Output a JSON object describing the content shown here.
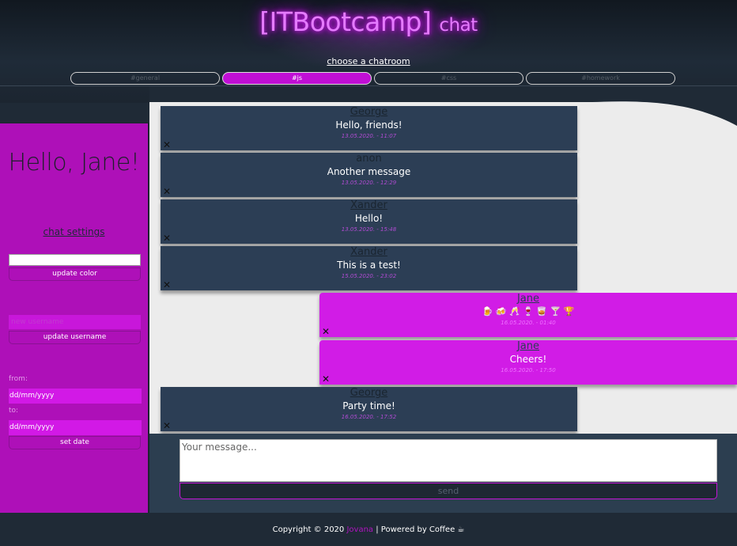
{
  "header": {
    "title_main": "[ITBootcamp]",
    "title_suffix": "chat",
    "choose_label": "choose a chatroom",
    "tabs": [
      {
        "label": "#general"
      },
      {
        "label": "#js"
      },
      {
        "label": "#css"
      },
      {
        "label": "#homework"
      }
    ],
    "active_tab": "#js"
  },
  "sidebar": {
    "greeting": "Hello, Jane!",
    "settings_link": "chat settings",
    "color_value": "",
    "update_color": "update color",
    "username_placeholder": "new username",
    "update_username": "update username",
    "from_label": "from:",
    "from_placeholder": "dd/mm/yyyy",
    "to_label": "to:",
    "to_placeholder": "dd/mm/yyyy",
    "set_date": "set date"
  },
  "messages": [
    {
      "author": "George",
      "text": "Hello, friends!",
      "time": "13.05.2020. - 11:07",
      "mine": false
    },
    {
      "author": "anon",
      "text": "Another message",
      "time": "13.05.2020. - 12:29",
      "mine": false
    },
    {
      "author": "Xander",
      "text": "Hello!",
      "time": "13.05.2020. - 15:48",
      "mine": false
    },
    {
      "author": "Xander",
      "text": "This is a test!",
      "time": "15.05.2020. - 23:02",
      "mine": false
    },
    {
      "author": "Jane",
      "text": "🍺 🍻 🥂 🍷 🥃 🍸 🏆",
      "time": "16.05.2020. - 01:40",
      "mine": true
    },
    {
      "author": "Jane",
      "text": "Cheers!",
      "time": "16.05.2020. - 17:50",
      "mine": true
    },
    {
      "author": "George",
      "text": "Party time!",
      "time": "16.05.2020. - 17:52",
      "mine": false
    }
  ],
  "composer": {
    "placeholder": "Your message...",
    "send_label": "send"
  },
  "footer": {
    "copyright": "Copyright © 2020",
    "author": "Jovana",
    "powered": "| Powered by Coffee ☕"
  },
  "colors": {
    "accent": "#c00fd4",
    "sidebar": "#ae10b8",
    "message_other": "#2c3e55",
    "message_mine": "#d11ce6"
  }
}
